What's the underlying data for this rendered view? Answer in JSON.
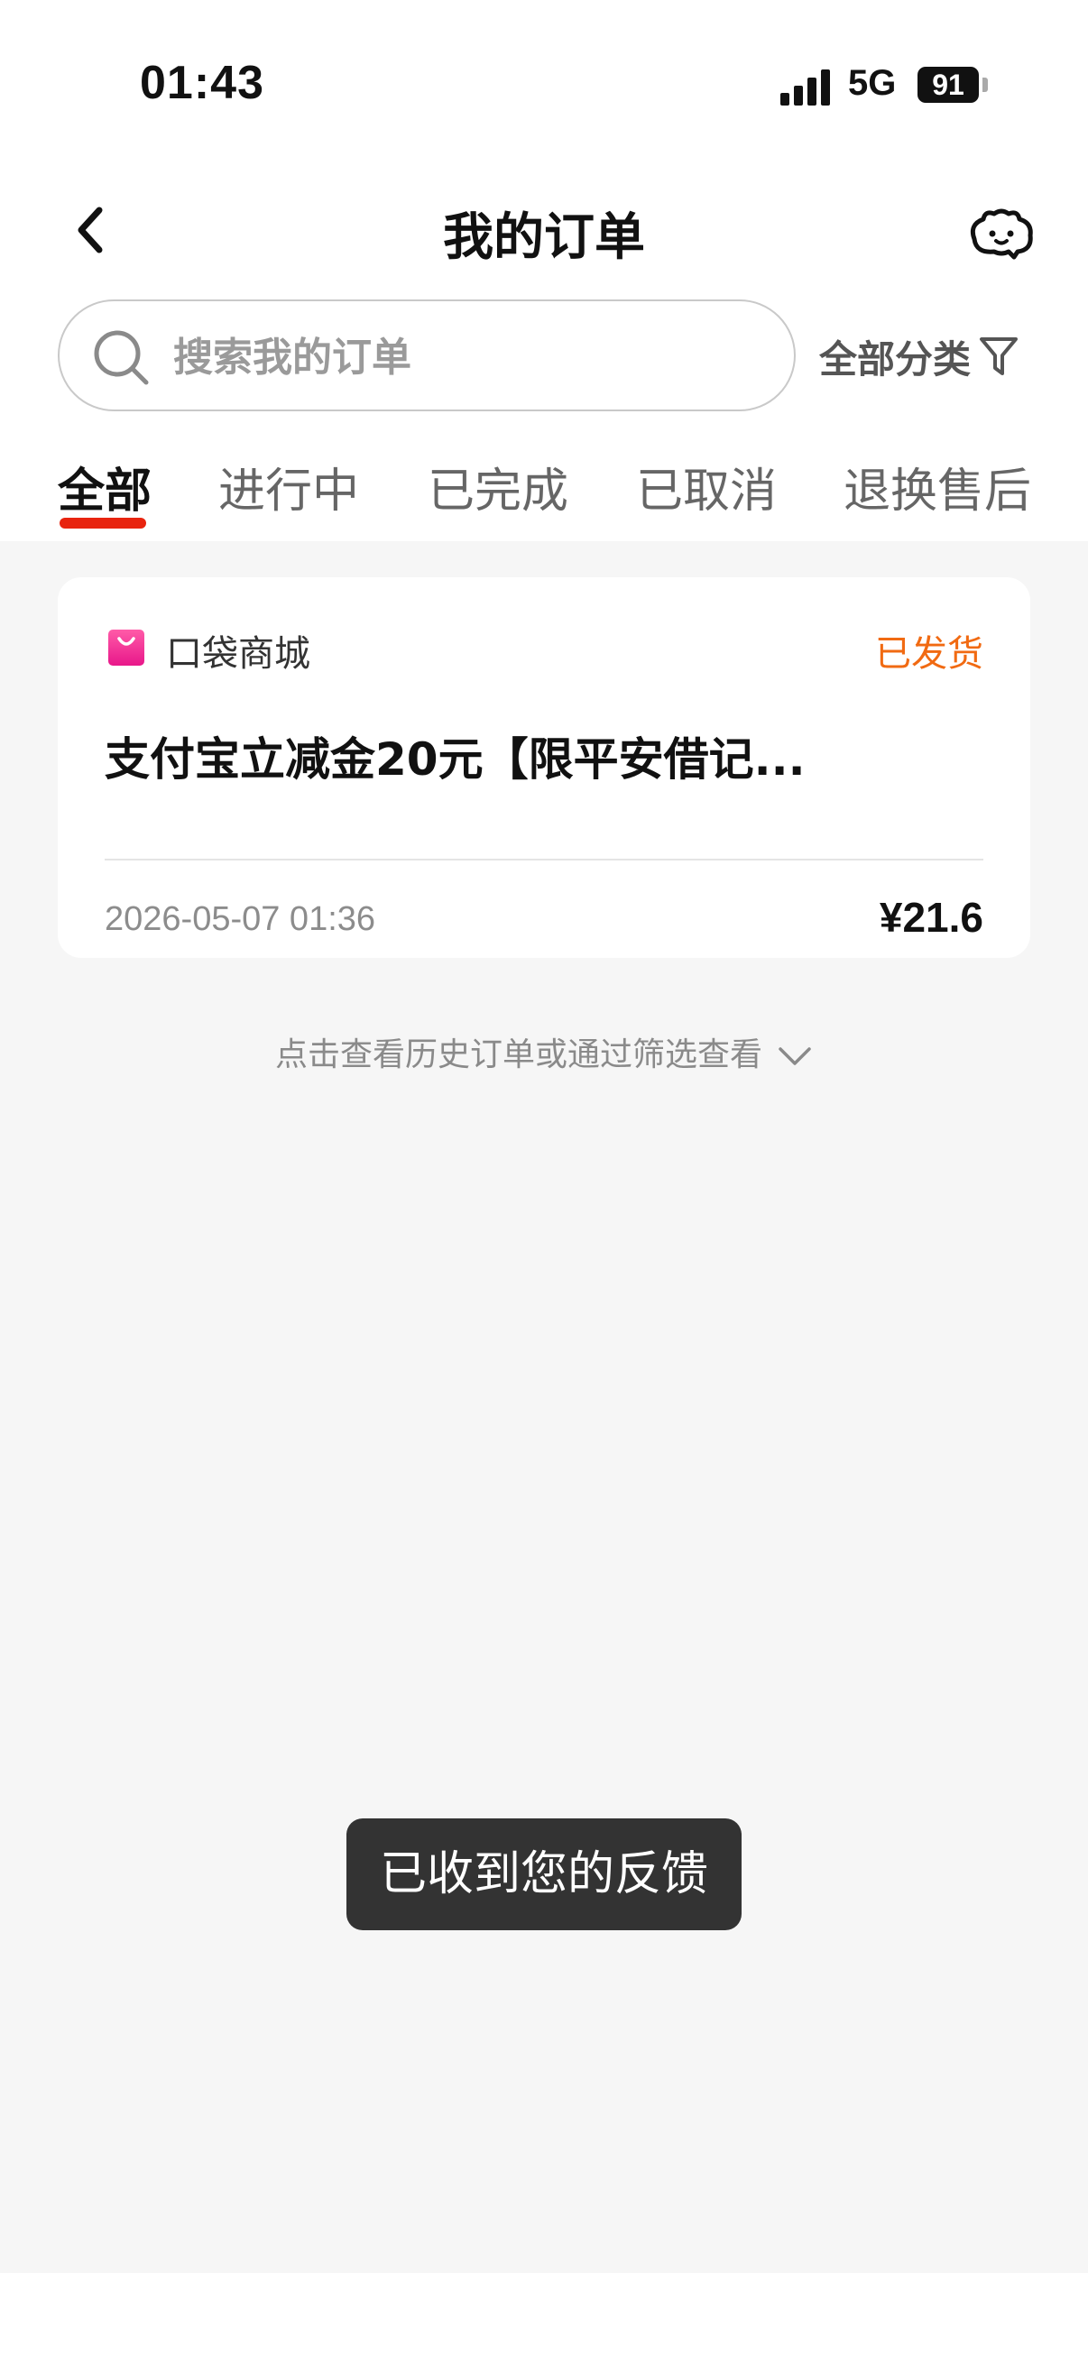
{
  "status_bar": {
    "time": "01:43",
    "network": "5G",
    "battery": "91"
  },
  "header": {
    "title": "我的订单",
    "back_icon": "chevron-left-icon",
    "service_icon": "customer-service-icon"
  },
  "search": {
    "placeholder": "搜索我的订单",
    "value": "",
    "filter_label": "全部分类",
    "filter_icon": "filter-icon"
  },
  "tabs": [
    {
      "label": "全部",
      "active": true
    },
    {
      "label": "进行中",
      "active": false
    },
    {
      "label": "已完成",
      "active": false
    },
    {
      "label": "已取消",
      "active": false
    },
    {
      "label": "退换售后",
      "active": false
    }
  ],
  "orders": [
    {
      "shop_name": "口袋商城",
      "status": "已发货",
      "title": "支付宝立减金20元【限平安借记...",
      "time": "2026-05-07 01:36",
      "price": "¥21.6"
    }
  ],
  "history_link": "点击查看历史订单或通过筛选查看",
  "toast": "已收到您的反馈",
  "colors": {
    "accent": "#e8240f",
    "status_orange": "#f16a12",
    "background": "#f6f6f6"
  }
}
